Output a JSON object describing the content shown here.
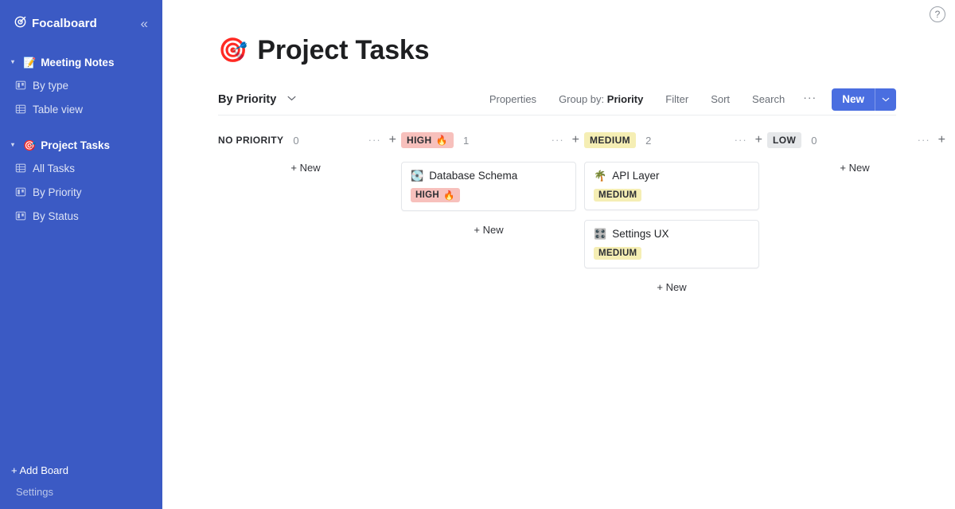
{
  "sidebar": {
    "brand": {
      "icon": "focalboard-logo-icon",
      "label": "Focalboard"
    },
    "collapse_icon": "«",
    "boards": [
      {
        "emoji": "📝",
        "label": "Meeting Notes",
        "caret": "▾",
        "views": [
          {
            "icon": "board-view-icon",
            "label": "By type"
          },
          {
            "icon": "table-view-icon",
            "label": "Table view"
          }
        ]
      },
      {
        "emoji": "🎯",
        "label": "Project Tasks",
        "caret": "▾",
        "views": [
          {
            "icon": "table-view-icon",
            "label": "All Tasks"
          },
          {
            "icon": "board-view-icon",
            "label": "By Priority"
          },
          {
            "icon": "board-view-icon",
            "label": "By Status"
          }
        ]
      }
    ],
    "add_board_label": "+ Add Board",
    "settings_label": "Settings"
  },
  "header": {
    "help_icon": "?",
    "emoji": "🎯",
    "title": "Project Tasks"
  },
  "toolbar": {
    "view_name": "By Priority",
    "view_chevron": "⌄",
    "properties_label": "Properties",
    "group_by_prefix": "Group by:",
    "group_by_value": "Priority",
    "filter_label": "Filter",
    "sort_label": "Sort",
    "search_label": "Search",
    "more_label": "···",
    "new_label": "New",
    "new_chevron": "⌄",
    "new_button_color": "#4a6ee0"
  },
  "board": {
    "add_card_label": "+ New",
    "column_dots": "···",
    "column_plus": "+",
    "columns": [
      {
        "title": "NO PRIORITY",
        "count": "0",
        "chip_bg": "transparent",
        "emoji": "",
        "cards": []
      },
      {
        "title": "HIGH",
        "count": "1",
        "chip_bg": "#f7c0bc",
        "emoji": "🔥",
        "cards": [
          {
            "emoji": "💽",
            "title": "Database Schema",
            "badge_label": "HIGH",
            "badge_emoji": "🔥",
            "badge_bg": "#f7c0bc"
          }
        ]
      },
      {
        "title": "MEDIUM",
        "count": "2",
        "chip_bg": "#f5eeb4",
        "emoji": "",
        "cards": [
          {
            "emoji": "🌴",
            "title": "API Layer",
            "badge_label": "MEDIUM",
            "badge_emoji": "",
            "badge_bg": "#f5eeb4"
          },
          {
            "emoji": "🎛️",
            "title": "Settings UX",
            "badge_label": "MEDIUM",
            "badge_emoji": "",
            "badge_bg": "#f5eeb4"
          }
        ]
      },
      {
        "title": "LOW",
        "count": "0",
        "chip_bg": "#e6e8ea",
        "emoji": "",
        "cards": []
      }
    ]
  }
}
